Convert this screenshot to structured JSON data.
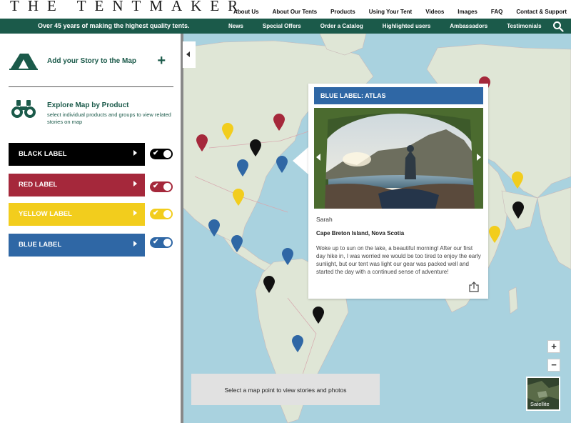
{
  "brand": {
    "logo_text": "THE TENTMAKER"
  },
  "top_nav": [
    "About Us",
    "About Our Tents",
    "Products",
    "Using Your Tent",
    "Videos",
    "Images",
    "FAQ",
    "Contact & Support"
  ],
  "sub_nav": {
    "tagline": "Over 45 years of making the highest quality tents.",
    "items": [
      "News",
      "Special Offers",
      "Order a Catalog",
      "Highlighted users",
      "Ambassadors",
      "Testimonials"
    ],
    "search_icon": "search-icon"
  },
  "sidebar": {
    "add_story": {
      "label": "Add your Story to the Map",
      "action": "+"
    },
    "explore": {
      "title": "Explore Map by Product",
      "description": "select individual products and groups to view related stories on map"
    },
    "labels": [
      {
        "name": "BLACK LABEL",
        "color": "#000000",
        "toggle_color": "#000000",
        "enabled": true
      },
      {
        "name": "RED LABEL",
        "color": "#a5283b",
        "toggle_color": "#a5283b",
        "enabled": true
      },
      {
        "name": "YELLOW LABEL",
        "color": "#f2cd1d",
        "toggle_color": "#f2cd1d",
        "enabled": true
      },
      {
        "name": "BLUE LABEL",
        "color": "#2f67a5",
        "toggle_color": "#2f67a5",
        "enabled": true
      }
    ]
  },
  "map": {
    "pin_colors": {
      "black": "#111111",
      "red": "#a5283b",
      "yellow": "#f2cd1d",
      "blue": "#2f67a5"
    },
    "popup": {
      "title": "BLUE LABEL: ATLAS",
      "author": "Sarah",
      "location": "Cape Breton Island, Nova Scotia",
      "story": "Woke up to sun on the lake, a beautiful morning! After our first day hike in, I was worried we would be too tired to enjoy the early sunlight, but our tent was light our gear was packed well and started the day with a continued sense of adventure!"
    },
    "info": "Select a map point to view stories and photos",
    "zoom_in": "+",
    "zoom_out": "−",
    "satellite": "Satellite"
  }
}
